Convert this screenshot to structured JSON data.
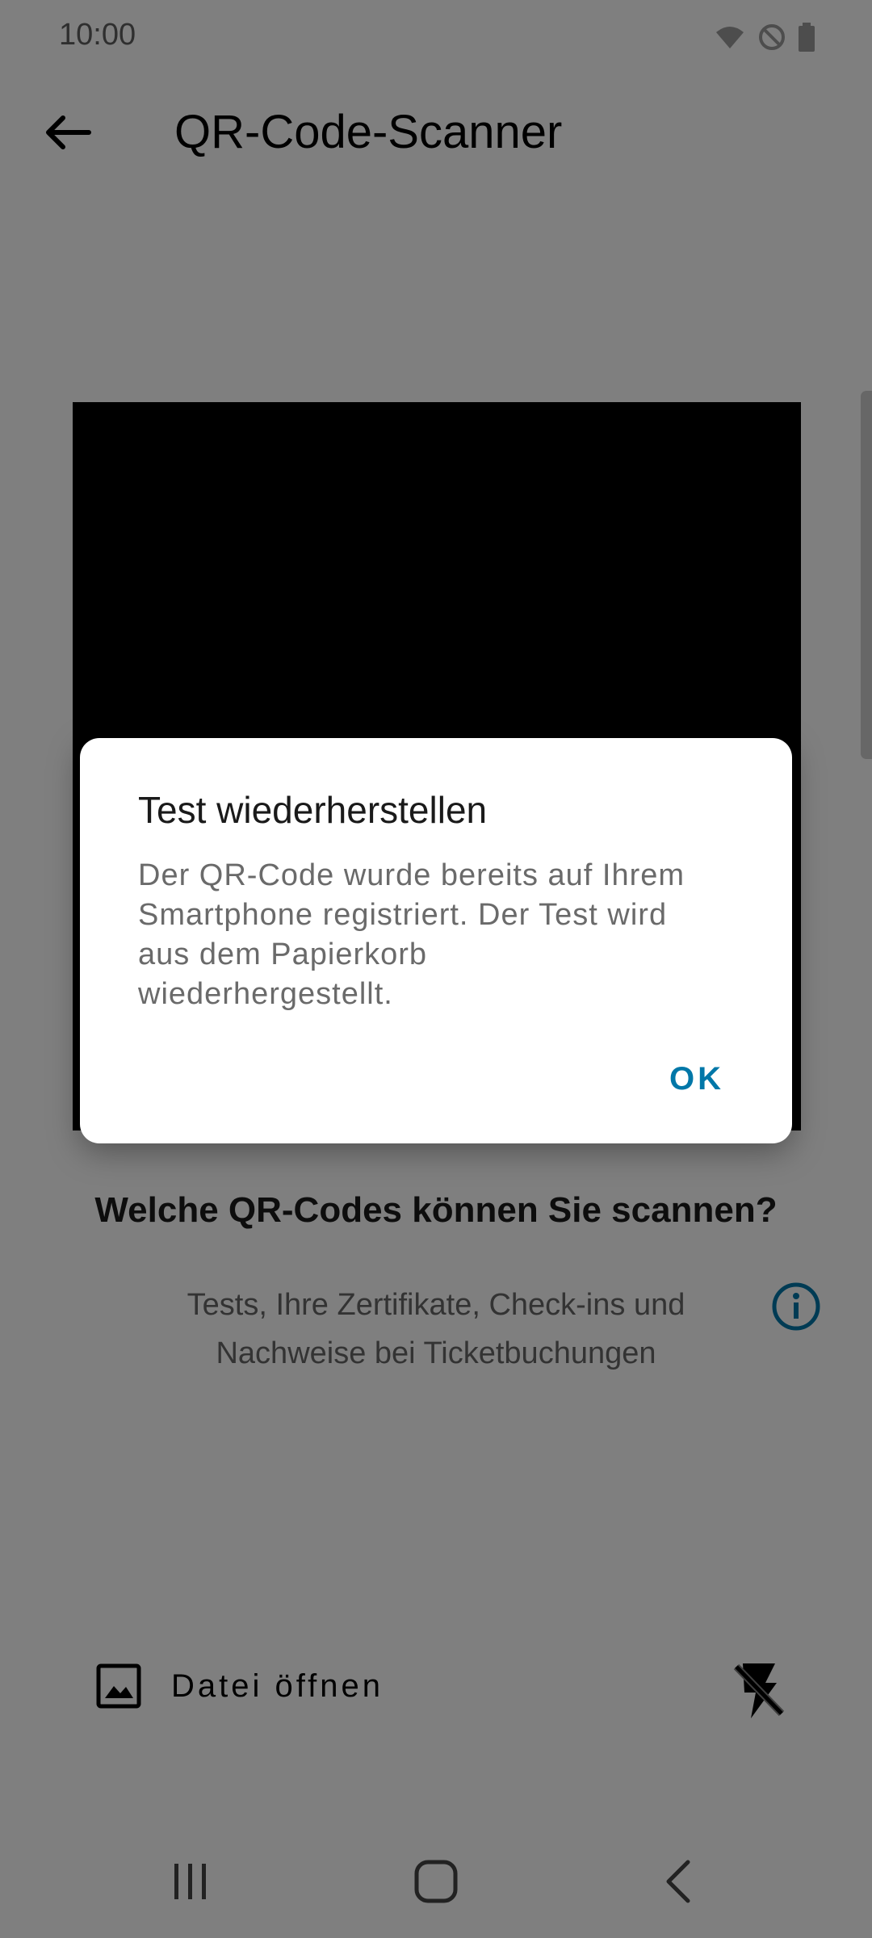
{
  "status_bar": {
    "time": "10:00",
    "icons": [
      "wifi-icon",
      "do-not-disturb-icon",
      "battery-icon"
    ]
  },
  "app_bar": {
    "title": "QR-Code-Scanner",
    "back_icon": "arrow-left-icon"
  },
  "main": {
    "help_title": "Welche QR-Codes können Sie scannen?",
    "help_text": "Tests, Ihre Zertifikate, Check-ins und Nachweise bei Ticketbuchungen",
    "info_icon": "info-icon",
    "open_file_label": "Datei öffnen",
    "open_file_icon": "image-icon",
    "flash_icon": "flash-off-icon"
  },
  "dialog": {
    "title": "Test wiederherstellen",
    "message": "Der QR-Code wurde bereits auf Ihrem Smartphone registriert. Der Test wird aus dem Papierkorb wiederhergestellt.",
    "ok_label": "OK"
  },
  "nav_bar": {
    "buttons": [
      "recent-apps-icon",
      "home-icon",
      "back-icon"
    ]
  },
  "colors": {
    "accent": "#0077a8",
    "scrim": "rgba(0,0,0,0.5)"
  }
}
